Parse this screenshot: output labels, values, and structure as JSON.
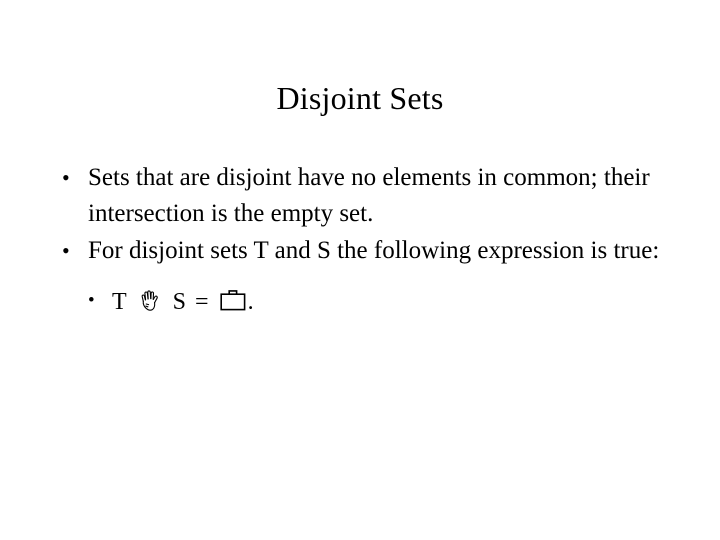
{
  "slide": {
    "title": "Disjoint Sets",
    "background_color": "#ffffff",
    "text_color": "#000000",
    "bullet_marker": "•",
    "bullets": [
      {
        "level": 1,
        "text": "Sets that are disjoint have no elements in common; their intersection is the empty set."
      },
      {
        "level": 1,
        "text": "For disjoint sets T and S the following expression is true:"
      }
    ],
    "formula": {
      "level": 2,
      "left_operand": "T",
      "operator_glyph": "open-hand-glyph",
      "operator_meaning": "intersection",
      "right_operand": "S",
      "equals": "=",
      "result_glyph": "briefcase-glyph",
      "result_meaning": "empty-set",
      "terminator": ".",
      "plain_text": "T ∩ S = ∅."
    }
  }
}
